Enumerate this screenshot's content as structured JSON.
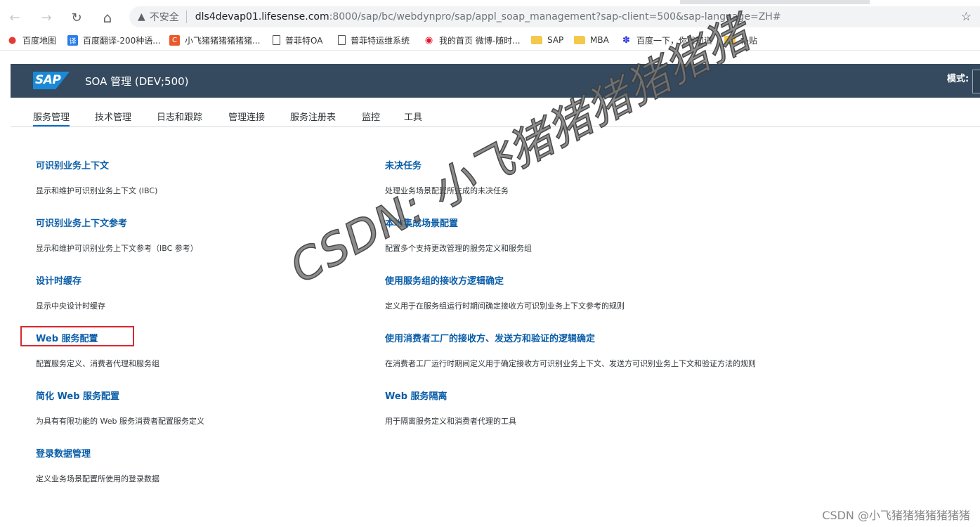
{
  "browser": {
    "nav": {
      "back": "←",
      "forward": "→",
      "reload": "↻",
      "home": "⌂"
    },
    "address": {
      "security_label": "不安全",
      "host": "dls4devap01.lifesense.com",
      "path": ":8000/sap/bc/webdynpro/sap/appl_soap_management?sap-client=500&sap-language=ZH#"
    },
    "bookmarks": [
      {
        "label": "百度地图",
        "icon": "map-pin-icon"
      },
      {
        "label": "百度翻译-200种语...",
        "icon": "translate-icon"
      },
      {
        "label": "小飞猪猪猪猪猪猪...",
        "icon": "csdn-icon"
      },
      {
        "label": "普菲特OA",
        "icon": "page-icon"
      },
      {
        "label": "普菲特运维系统",
        "icon": "page-icon"
      },
      {
        "label": "我的首页 微博-随时...",
        "icon": "weibo-icon"
      },
      {
        "label": "SAP",
        "icon": "folder-icon"
      },
      {
        "label": "MBA",
        "icon": "folder-icon"
      },
      {
        "label": "百度一下，你就知道",
        "icon": "baidu-paw-icon"
      },
      {
        "label": "补贴",
        "icon": "folder-icon"
      }
    ]
  },
  "shell": {
    "logo_text": "SAP",
    "title": "SOA 管理 (DEV;500)",
    "mode_label": "模式:"
  },
  "tabs": [
    {
      "label": "服务管理",
      "active": true
    },
    {
      "label": "技术管理",
      "active": false
    },
    {
      "label": "日志和跟踪",
      "active": false
    },
    {
      "label": "管理连接",
      "active": false
    },
    {
      "label": "服务注册表",
      "active": false
    },
    {
      "label": "监控",
      "active": false
    },
    {
      "label": "工具",
      "active": false
    }
  ],
  "left_items": [
    {
      "title": "可识别业务上下文",
      "desc": "显示和维护可识别业务上下文 (IBC)"
    },
    {
      "title": "可识别业务上下文参考",
      "desc": "显示和维护可识别业务上下文参考（IBC 参考）"
    },
    {
      "title": "设计时缓存",
      "desc": "显示中央设计时缓存"
    },
    {
      "title": "Web 服务配置",
      "desc": "配置服务定义、消费者代理和服务组"
    },
    {
      "title": "简化 Web 服务配置",
      "desc": "为具有有限功能的 Web 服务消费者配置服务定义"
    },
    {
      "title": "登录数据管理",
      "desc": "定义业务场景配置所使用的登录数据"
    }
  ],
  "right_items": [
    {
      "title": "未决任务",
      "desc": "处理业务场景配置所生成的未决任务"
    },
    {
      "title": "本地集成场景配置",
      "desc": "配置多个支持更改管理的服务定义和服务组"
    },
    {
      "title": "使用服务组的接收方逻辑确定",
      "desc": "定义用于在服务组运行时期间确定接收方可识别业务上下文参考的规则"
    },
    {
      "title": "使用消费者工厂的接收方、发送方和验证的逻辑确定",
      "desc": "在消费者工厂运行时期间定义用于确定接收方可识别业务上下文、发送方可识别业务上下文和验证方法的规则"
    },
    {
      "title": "Web 服务隔离",
      "desc": "用于隔离服务定义和消费者代理的工具"
    }
  ],
  "watermark": "CSDN: 小飞猪猪猪猪猪猪",
  "footer_mark": "CSDN @小飞猪猪猪猪猪猪猪",
  "colors": {
    "shell_bg": "#354a5f",
    "link": "#0a5ea8",
    "tab_underline": "#0a6ed1",
    "highlight": "#d9282f"
  }
}
